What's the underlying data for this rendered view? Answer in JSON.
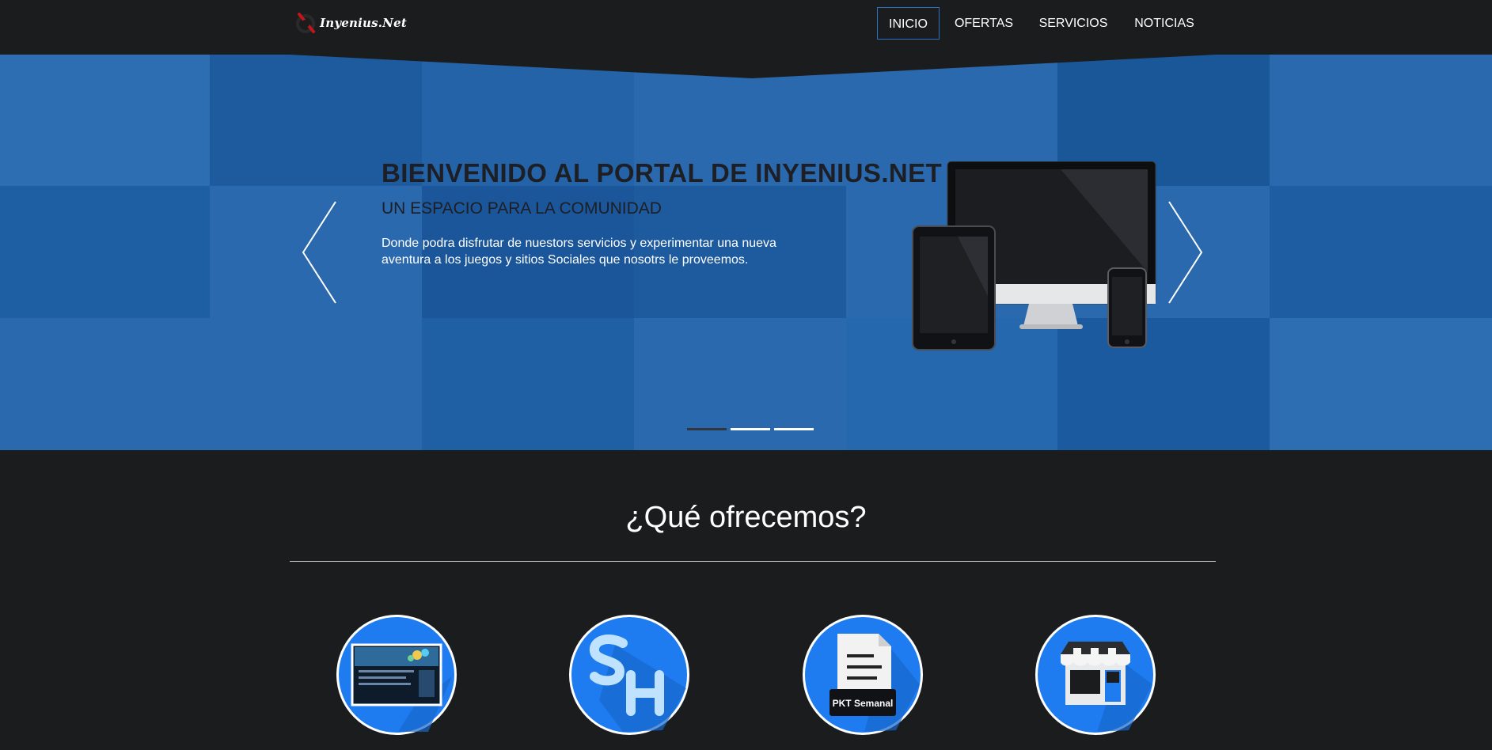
{
  "logo": {
    "text": "Inyenius.Net"
  },
  "nav": {
    "items": [
      {
        "label": "INICIO",
        "active": true
      },
      {
        "label": "OFERTAS",
        "active": false
      },
      {
        "label": "SERVICIOS",
        "active": false
      },
      {
        "label": "NOTICIAS",
        "active": false
      }
    ]
  },
  "hero": {
    "title": "BIENVENIDO AL PORTAL DE INYENIUS.NET",
    "subtitle": "UN ESPACIO PARA LA COMUNIDAD",
    "description": "Donde podra disfrutar de nuestors servicios y experimentar una nueva aventura a los juegos y sitios Sociales que nosotrs le proveemos.",
    "prev_icon": "chevron-left-icon",
    "next_icon": "chevron-right-icon",
    "slides_count": 3,
    "active_slide": 1
  },
  "offers": {
    "title": "¿Qué ofrecemos?",
    "items": [
      {
        "icon": "website-screen-icon"
      },
      {
        "icon": "sh-logo-icon"
      },
      {
        "icon": "pkt-newsletter-icon",
        "label": "PKT Semanal"
      },
      {
        "icon": "store-front-icon"
      }
    ]
  },
  "colors": {
    "page_bg": "#1b1c1e",
    "hero_blue": "#2a69ad",
    "accent_blue": "#1f7cf0",
    "nav_active_border": "#2f6fc1",
    "text_dark": "#1d1f24"
  }
}
